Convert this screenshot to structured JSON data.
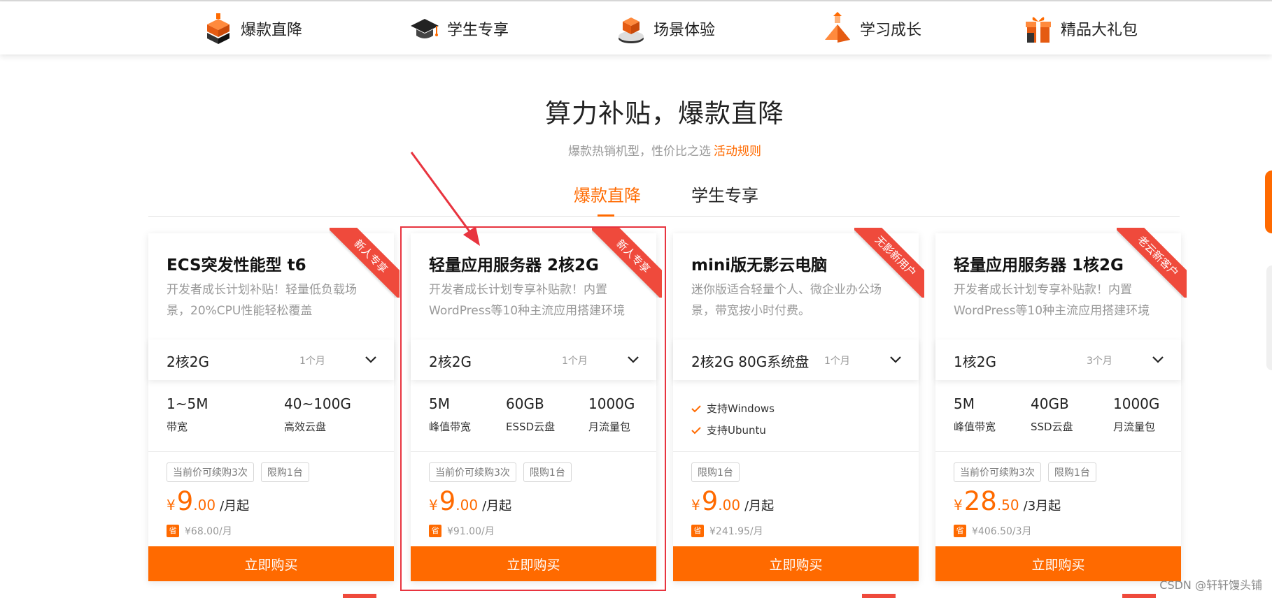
{
  "topnav": {
    "items": [
      {
        "label": "爆款直降",
        "icon": "box-stack-icon"
      },
      {
        "label": "学生专享",
        "icon": "graduation-cap-icon"
      },
      {
        "label": "场景体验",
        "icon": "cube-stage-icon"
      },
      {
        "label": "学习成长",
        "icon": "pyramid-growth-icon"
      },
      {
        "label": "精品大礼包",
        "icon": "gift-box-icon"
      }
    ]
  },
  "header": {
    "title": "算力补贴，爆款直降",
    "subtitle": "爆款热销机型，性价比之选",
    "rules_link": "活动规则"
  },
  "tabs": [
    {
      "label": "爆款直降",
      "active": true
    },
    {
      "label": "学生专享",
      "active": false
    }
  ],
  "colors": {
    "accent": "#ff6a00",
    "ribbon": "#ef4a3c",
    "annotation": "#e8343f"
  },
  "cards": [
    {
      "ribbon": "新人专享",
      "title": "ECS突发性能型 t6",
      "desc": "开发者成长计划补贴！轻量低负载场景，20%CPU性能轻松覆盖",
      "spec": "2核2G",
      "period": "1个月",
      "metrics": [
        {
          "value": "1~5M",
          "label": "带宽"
        },
        {
          "value": "40~100G",
          "label": "高效云盘"
        }
      ],
      "tags": [
        "当前价可续购3次",
        "限购1台"
      ],
      "price_symbol": "¥",
      "price_int": "9",
      "price_dec": ".00",
      "price_unit": "/月起",
      "save_badge": "省",
      "original_price": "¥68.00/月",
      "buy_label": "立即购买"
    },
    {
      "ribbon": "新人专享",
      "title": "轻量应用服务器 2核2G",
      "desc": "开发者成长计划专享补贴款！内置WordPress等10种主流应用搭建环境",
      "spec": "2核2G",
      "period": "1个月",
      "metrics": [
        {
          "value": "5M",
          "label": "峰值带宽"
        },
        {
          "value": "60GB",
          "label": "ESSD云盘"
        },
        {
          "value": "1000G",
          "label": "月流量包"
        }
      ],
      "tags": [
        "当前价可续购3次",
        "限购1台"
      ],
      "price_symbol": "¥",
      "price_int": "9",
      "price_dec": ".00",
      "price_unit": "/月起",
      "save_badge": "省",
      "original_price": "¥91.00/月",
      "buy_label": "立即购买"
    },
    {
      "ribbon": "无影新用户",
      "title": "mini版无影云电脑",
      "desc": "迷你版适合轻量个人、微企业办公场景，带宽按小时付费。",
      "spec": "2核2G 80G系统盘",
      "period": "1个月",
      "features": [
        "支持Windows",
        "支持Ubuntu"
      ],
      "tags": [
        "限购1台"
      ],
      "price_symbol": "¥",
      "price_int": "9",
      "price_dec": ".00",
      "price_unit": "/月起",
      "save_badge": "省",
      "original_price": "¥241.95/月",
      "buy_label": "立即购买"
    },
    {
      "ribbon": "老云新客户",
      "title": "轻量应用服务器 1核2G",
      "desc": "开发者成长计划专享补贴款！内置WordPress等10种主流应用搭建环境",
      "spec": "1核2G",
      "period": "3个月",
      "metrics": [
        {
          "value": "5M",
          "label": "峰值带宽"
        },
        {
          "value": "40GB",
          "label": "SSD云盘"
        },
        {
          "value": "1000G",
          "label": "月流量包"
        }
      ],
      "tags": [
        "当前价可续购3次",
        "限购1台"
      ],
      "price_symbol": "¥",
      "price_int": "28",
      "price_dec": ".50",
      "price_unit": "/3月起",
      "save_badge": "省",
      "original_price": "¥406.50/3月",
      "buy_label": "立即购买"
    }
  ],
  "watermark": "CSDN @轩轩馒头铺"
}
